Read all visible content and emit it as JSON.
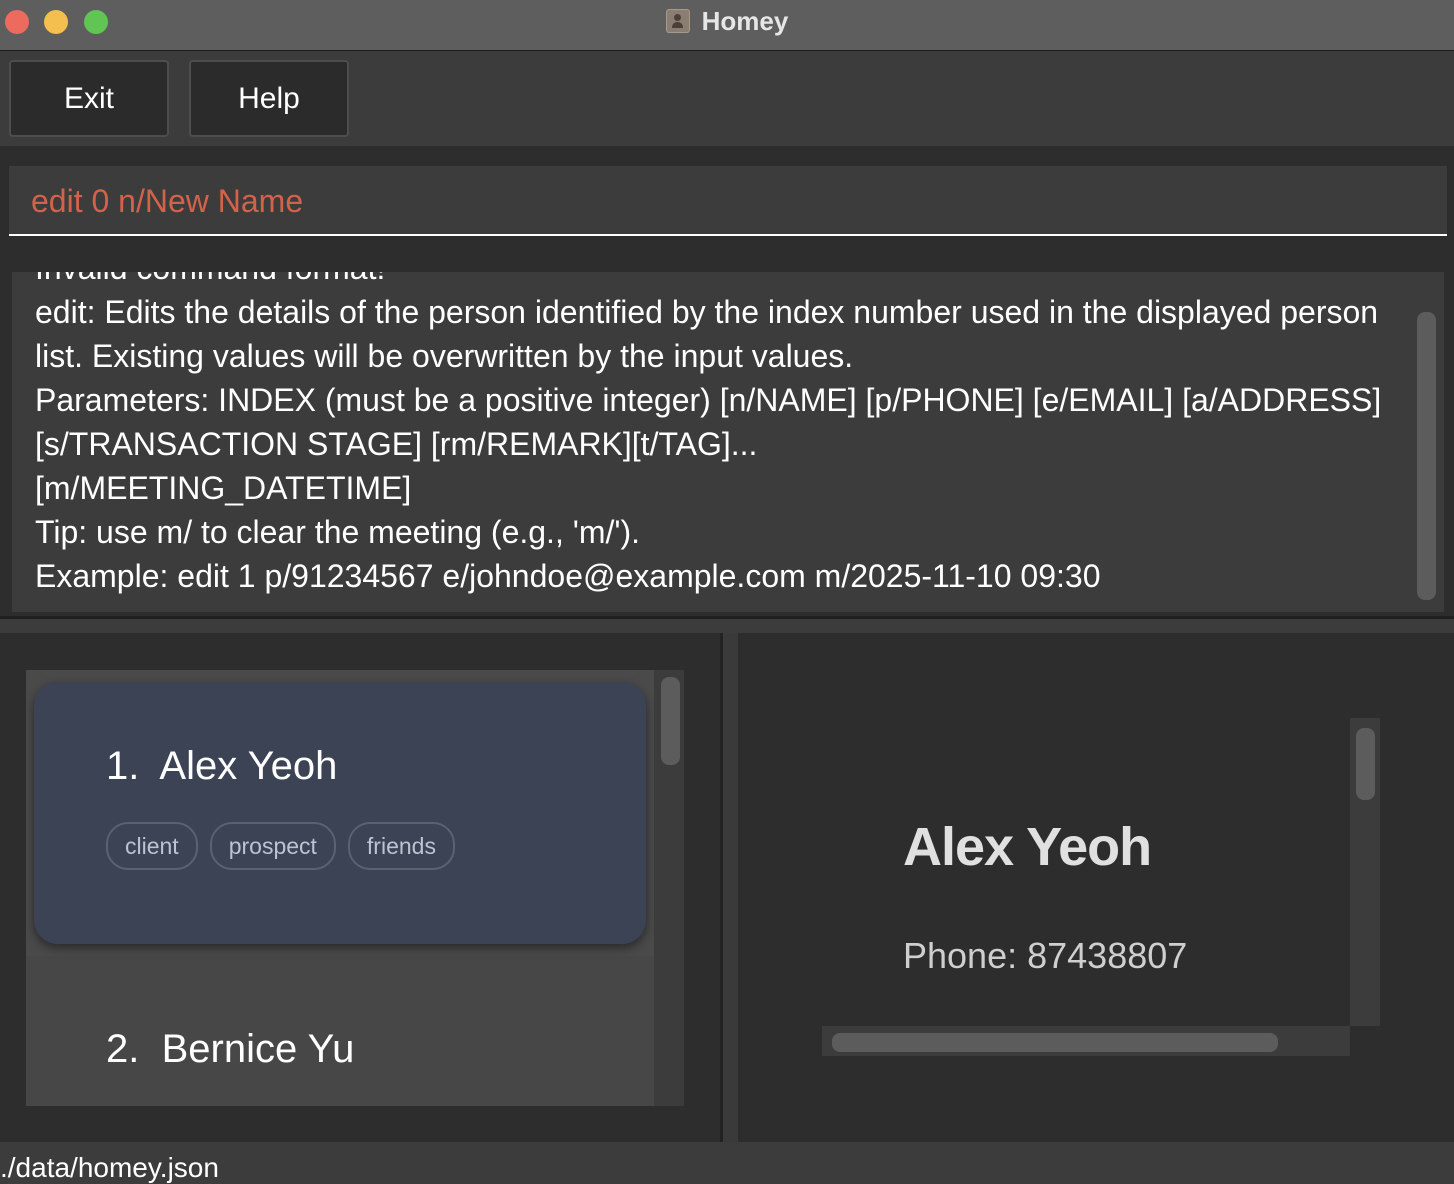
{
  "window": {
    "title": "Homey",
    "icon": "address-book-icon",
    "controls": [
      "close",
      "minimize",
      "zoom"
    ]
  },
  "menu": {
    "exit_label": "Exit",
    "help_label": "Help"
  },
  "command_box": {
    "value": "edit 0 n/New Name",
    "text_color": "#d3624a"
  },
  "result_display": {
    "text": "Invalid command format!\nedit: Edits the details of the person identified by the index number used in the displayed person list. Existing values will be overwritten by the input values.\nParameters: INDEX (must be a positive integer) [n/NAME] [p/PHONE] [e/EMAIL] [a/ADDRESS] [s/TRANSACTION STAGE] [rm/REMARK][t/TAG]...\n[m/MEETING_DATETIME]\nTip: use m/ to clear the meeting (e.g., 'm/').\nExample: edit 1 p/91234567 e/johndoe@example.com m/2025-11-10 09:30"
  },
  "person_list": {
    "items": [
      {
        "index": "1.",
        "name": "Alex Yeoh",
        "tags": [
          "client",
          "prospect",
          "friends"
        ],
        "selected": true
      },
      {
        "index": "2.",
        "name": "Bernice Yu",
        "tags": [],
        "selected": false
      }
    ],
    "card_color": "#3b4354"
  },
  "person_detail": {
    "name": "Alex Yeoh",
    "phone_line": "Phone: 87438807"
  },
  "status_bar": {
    "path": "./data/homey.json"
  }
}
